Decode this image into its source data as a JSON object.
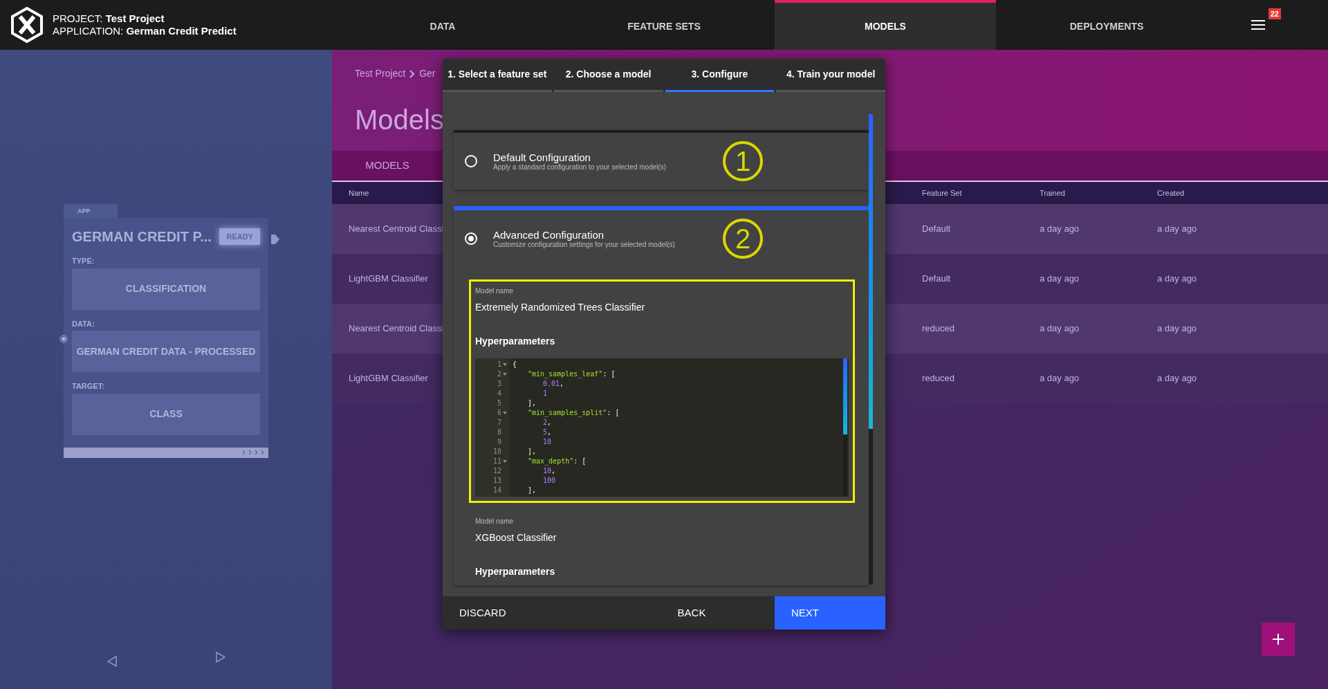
{
  "header": {
    "project_label": "PROJECT:",
    "project": "Test Project",
    "application_label": "APPLICATION:",
    "application": "German Credit Predict",
    "nav": [
      {
        "label": "DATA",
        "selected": false
      },
      {
        "label": "FEATURE SETS",
        "selected": false
      },
      {
        "label": "MODELS",
        "selected": true
      },
      {
        "label": "DEPLOYMENTS",
        "selected": false
      }
    ],
    "notification_count": "22"
  },
  "app_card": {
    "tab": "APP",
    "title": "GERMAN CREDIT P...",
    "status": "READY",
    "fields": [
      {
        "label": "TYPE:",
        "value": "CLASSIFICATION"
      },
      {
        "label": "DATA:",
        "value": "GERMAN CREDIT DATA - PROCESSED"
      },
      {
        "label": "TARGET:",
        "value": "CLASS"
      }
    ]
  },
  "breadcrumb": [
    "Test Project",
    "Ger"
  ],
  "page_title": "Models",
  "page_tabs": [
    {
      "label": "MODELS",
      "selected": true
    }
  ],
  "table": {
    "columns": [
      "Name",
      "Feature Set",
      "Trained",
      "Created"
    ],
    "rows": [
      [
        "Nearest Centroid Classi",
        "Default",
        "a day ago",
        "a day ago"
      ],
      [
        "LightGBM Classifier",
        "Default",
        "a day ago",
        "a day ago"
      ],
      [
        "Nearest Centroid Classi",
        "reduced",
        "a day ago",
        "a day ago"
      ],
      [
        "LightGBM Classifier",
        "reduced",
        "a day ago",
        "a day ago"
      ]
    ]
  },
  "dialog": {
    "steps": [
      {
        "label": "1. Select a feature set",
        "selected": false
      },
      {
        "label": "2. Choose a model",
        "selected": false
      },
      {
        "label": "3. Configure",
        "selected": true
      },
      {
        "label": "4. Train your model",
        "selected": false
      }
    ],
    "options": [
      {
        "title": "Default Configuration",
        "description": "Apply a standard configuration to your selected model(s)",
        "selected": false,
        "annotation": "1"
      },
      {
        "title": "Advanced Configuration",
        "description": "Customize configuration settings for your selected model(s)",
        "selected": true,
        "annotation": "2"
      }
    ],
    "models": [
      {
        "name_label": "Model name",
        "name": "Extremely Randomized Trees Classifier",
        "hyper_label": "Hyperparameters",
        "highlighted": true,
        "code": [
          {
            "number": "1",
            "fold": true,
            "tokens": [
              {
                "kind": "punct",
                "text": "{"
              }
            ]
          },
          {
            "number": "2",
            "fold": true,
            "tokens": [
              {
                "kind": "key",
                "text": "\"min_samples_leaf\""
              },
              {
                "kind": "punct",
                "text": ": ["
              }
            ]
          },
          {
            "number": "3",
            "fold": false,
            "tokens": [
              {
                "kind": "number",
                "text": "0.01"
              },
              {
                "kind": "punct",
                "text": ","
              }
            ]
          },
          {
            "number": "4",
            "fold": false,
            "tokens": [
              {
                "kind": "number",
                "text": "1"
              }
            ]
          },
          {
            "number": "5",
            "fold": false,
            "tokens": [
              {
                "kind": "punct",
                "text": "],"
              }
            ]
          },
          {
            "number": "6",
            "fold": true,
            "tokens": [
              {
                "kind": "key",
                "text": "\"min_samples_split\""
              },
              {
                "kind": "punct",
                "text": ": ["
              }
            ]
          },
          {
            "number": "7",
            "fold": false,
            "tokens": [
              {
                "kind": "number",
                "text": "2"
              },
              {
                "kind": "punct",
                "text": ","
              }
            ]
          },
          {
            "number": "8",
            "fold": false,
            "tokens": [
              {
                "kind": "number",
                "text": "5"
              },
              {
                "kind": "punct",
                "text": ","
              }
            ]
          },
          {
            "number": "9",
            "fold": false,
            "tokens": [
              {
                "kind": "number",
                "text": "10"
              }
            ]
          },
          {
            "number": "10",
            "fold": false,
            "tokens": [
              {
                "kind": "punct",
                "text": "],"
              }
            ]
          },
          {
            "number": "11",
            "fold": true,
            "tokens": [
              {
                "kind": "key",
                "text": "\"max_depth\""
              },
              {
                "kind": "punct",
                "text": ": ["
              }
            ]
          },
          {
            "number": "12",
            "fold": false,
            "tokens": [
              {
                "kind": "number",
                "text": "10"
              },
              {
                "kind": "punct",
                "text": ","
              }
            ]
          },
          {
            "number": "13",
            "fold": false,
            "tokens": [
              {
                "kind": "number",
                "text": "100"
              }
            ]
          },
          {
            "number": "14",
            "fold": false,
            "tokens": [
              {
                "kind": "punct",
                "text": "],"
              }
            ]
          }
        ]
      },
      {
        "name_label": "Model name",
        "name": "XGBoost Classifier",
        "hyper_label": "Hyperparameters",
        "highlighted": false
      }
    ],
    "buttons": [
      {
        "label": "DISCARD",
        "kind": "plain"
      },
      {
        "label": "BACK",
        "kind": "plain"
      },
      {
        "label": "NEXT",
        "kind": "primary"
      }
    ]
  }
}
